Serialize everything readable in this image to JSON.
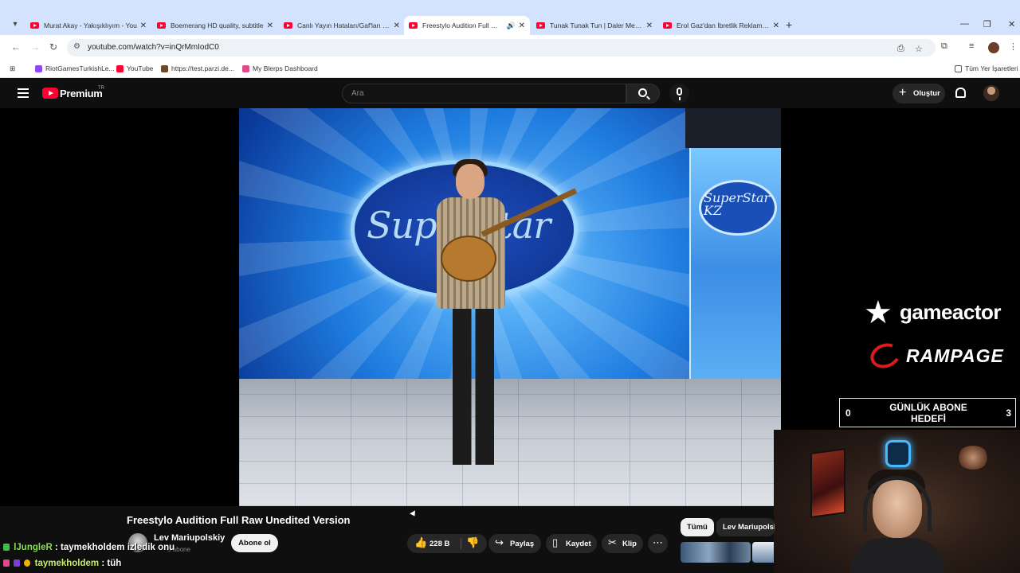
{
  "browser": {
    "tabs": [
      {
        "title": "Murat Akay - Yakışıklıyım - You"
      },
      {
        "title": "Boemerang HD quality, subtitle"
      },
      {
        "title": "Canlı Yayın Hataları/Gaf'ları - Yo"
      },
      {
        "title": "Freestylo Audition Full Raw",
        "active": true
      },
      {
        "title": "Tunak Tunak Tun | Daler Mehnd"
      },
      {
        "title": "Erol Gaz'dan İbretlik Reklam - Y"
      }
    ],
    "url": "youtube.com/watch?v=inQrMmIodC0",
    "bookmarks": [
      {
        "label": "RiotGamesTurkishLe...",
        "icon_color": "#9146ff"
      },
      {
        "label": "YouTube",
        "icon_color": "#ff0033"
      },
      {
        "label": "https://test.parzi.de...",
        "icon_color": "#6b4a2a"
      },
      {
        "label": "My Blerps Dashboard",
        "icon_color": "#e04a8a"
      }
    ],
    "all_bookmarks_label": "Tüm Yer İşaretleri"
  },
  "youtube": {
    "brand": "Premium",
    "country": "TR",
    "search_placeholder": "Ara",
    "create_label": "Oluştur"
  },
  "video": {
    "title": "Freestylo Audition Full Raw Unedited Version",
    "overlay_logo_text": "SuperStar",
    "side_logo_text": "SuperStar KZ"
  },
  "channel": {
    "name": "Lev Mariupolskiy",
    "subs": "8 abone",
    "subscribe_label": "Abone ol"
  },
  "actions": {
    "likes": "228 B",
    "share": "Paylaş",
    "save": "Kaydet",
    "clip": "Klip"
  },
  "related": {
    "chips": [
      "Tümü",
      "Lev Mariupolsk"
    ]
  },
  "overlays": {
    "gameactor": "gameactor",
    "rampage": "RAMPAGE",
    "goal_label": "GÜNLÜK ABONE HEDEFİ",
    "goal_current": "0",
    "goal_target": "3"
  },
  "chat": [
    {
      "user": "lJungleR",
      "message": ": taymekholdem izledik onu",
      "color": "#88e04e"
    },
    {
      "user": "taymekholdem",
      "message": ": tüh",
      "color": "#c8f06a"
    }
  ]
}
